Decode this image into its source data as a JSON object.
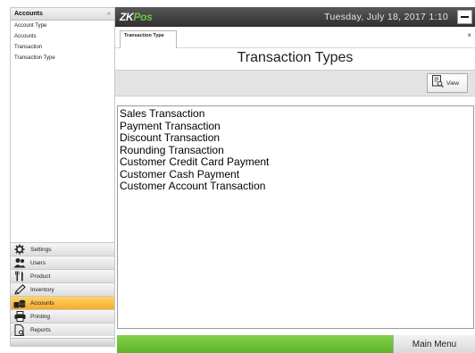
{
  "sidebar": {
    "title": "Accounts",
    "collapse_glyph": "«",
    "sub_items": [
      "Account Type",
      "Accounts",
      "Transaction",
      "Transaction Type"
    ],
    "modules": [
      {
        "label": "Settings",
        "icon": "gear-icon",
        "active": false
      },
      {
        "label": "Users",
        "icon": "users-icon",
        "active": false
      },
      {
        "label": "Product",
        "icon": "fork-knife-icon",
        "active": false
      },
      {
        "label": "Inventory",
        "icon": "pencil-icon",
        "active": false
      },
      {
        "label": "Accounts",
        "icon": "coins-icon",
        "active": true
      },
      {
        "label": "Printing",
        "icon": "printer-icon",
        "active": false
      },
      {
        "label": "Reports",
        "icon": "report-icon",
        "active": false
      }
    ]
  },
  "header": {
    "logo_zk": "ZK",
    "logo_pos": "Pos",
    "datetime": "Tuesday, July 18, 2017 1:10"
  },
  "tab": {
    "label": "Transaction Type",
    "close_glyph": "×"
  },
  "page": {
    "title": "Transaction Types"
  },
  "toolbar": {
    "view_label": "View"
  },
  "list": {
    "items": [
      "Sales Transaction",
      "Payment Transaction",
      "Discount Transaction",
      "Rounding Transaction",
      "Customer Credit Card Payment",
      "Customer Cash Payment",
      "Customer Account Transaction"
    ]
  },
  "footer": {
    "main_menu_label": "Main Menu"
  },
  "colors": {
    "accent_green": "#6cc24a",
    "active_module": "#f6a92a",
    "topbar": "#3d3d3d"
  }
}
